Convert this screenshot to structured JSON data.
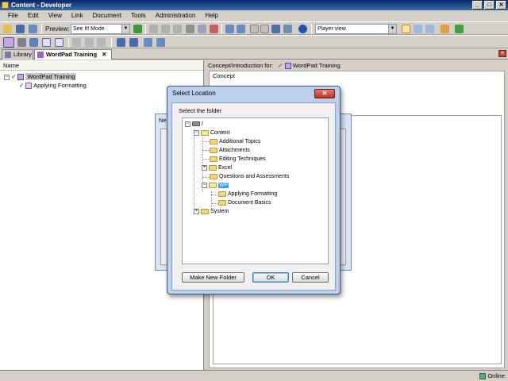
{
  "window": {
    "title": "Content - Developer"
  },
  "menu": [
    "File",
    "Edit",
    "View",
    "Link",
    "Document",
    "Tools",
    "Administration",
    "Help"
  ],
  "toolbar": {
    "preview_label": "Preview:",
    "preview_mode": "See It! Mode",
    "player_view": "Player view"
  },
  "tabs": [
    {
      "label": "Library"
    },
    {
      "label": "WordPad Training"
    }
  ],
  "left_pane": {
    "header": "Name",
    "tree": [
      {
        "label": "WordPad Training"
      },
      {
        "label": "Applying Formatting"
      }
    ]
  },
  "right_pane": {
    "header": "Concept/Introduction for:",
    "header_doc": "WordPad Training",
    "concept_label": "Concept"
  },
  "bg_dialog": {
    "title": "Ne"
  },
  "dialog": {
    "title": "Select Location",
    "prompt": "Select the folder",
    "tree": {
      "root": "/",
      "content": "Content",
      "folders": [
        "Additional Topics",
        "Attachments",
        "Editing Techniques",
        "Excel",
        "Questions and Assessments",
        "WP"
      ],
      "wp_children": [
        "Applying Formatting",
        "Document Basics"
      ],
      "system": "System"
    },
    "buttons": {
      "make_new_folder": "Make New Folder",
      "ok": "OK",
      "cancel": "Cancel"
    }
  },
  "status": {
    "text": "Online"
  }
}
